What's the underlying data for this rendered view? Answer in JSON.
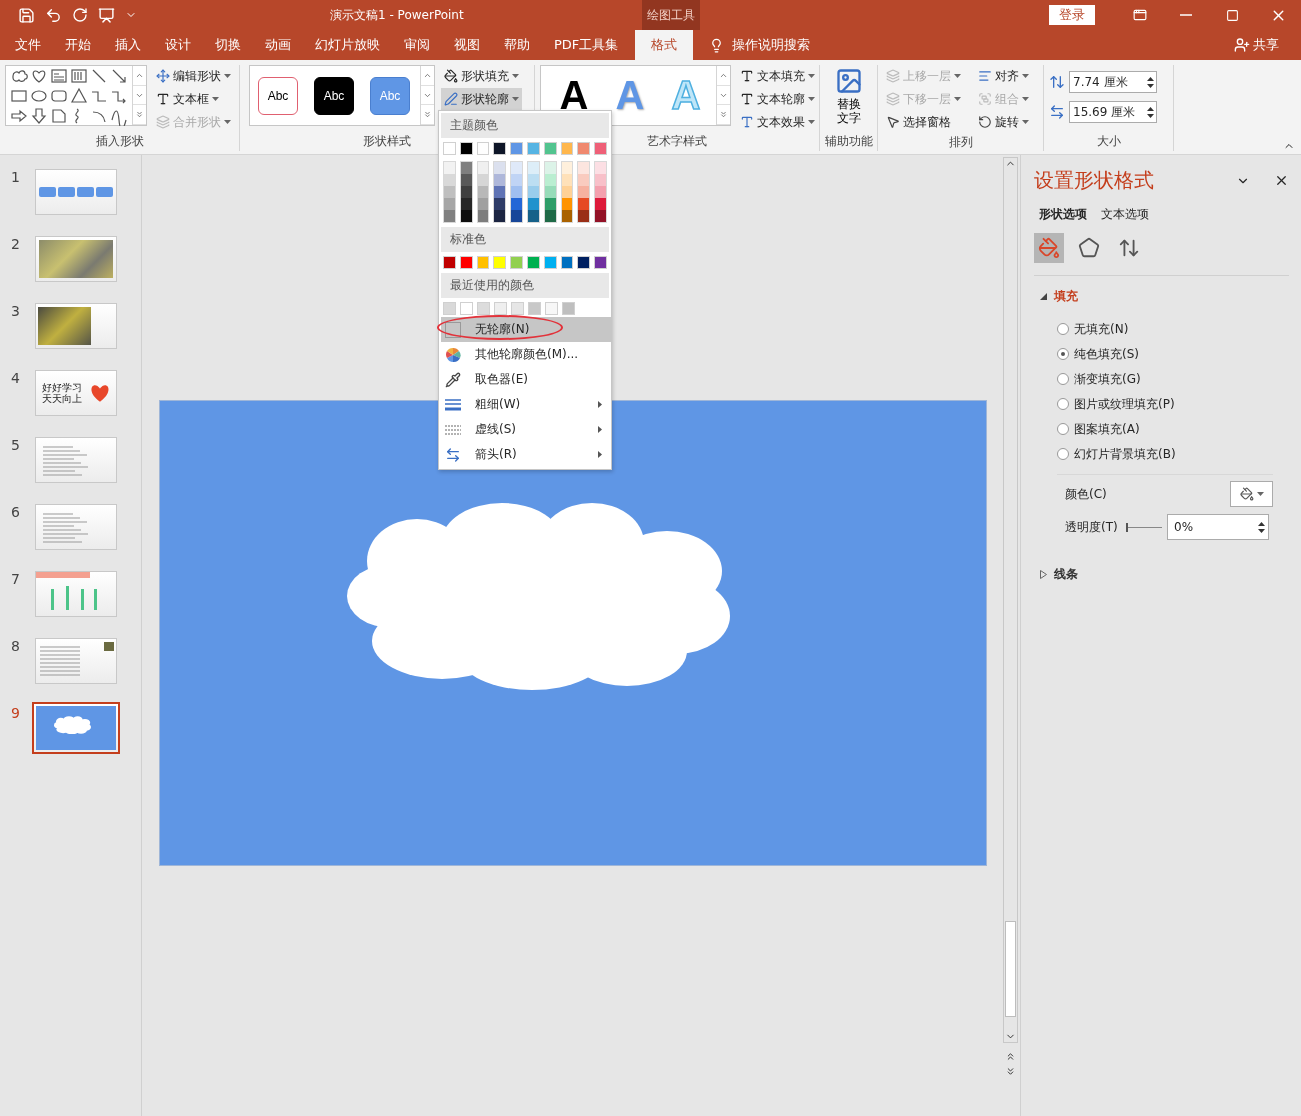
{
  "window": {
    "title": "演示文稿1  -  PowerPoint",
    "context_tab": "绘图工具",
    "login": "登录"
  },
  "tabs": [
    {
      "label": "文件",
      "selected": false
    },
    {
      "label": "开始",
      "selected": false
    },
    {
      "label": "插入",
      "selected": false
    },
    {
      "label": "设计",
      "selected": false
    },
    {
      "label": "切换",
      "selected": false
    },
    {
      "label": "动画",
      "selected": false
    },
    {
      "label": "幻灯片放映",
      "selected": false
    },
    {
      "label": "审阅",
      "selected": false
    },
    {
      "label": "视图",
      "selected": false
    },
    {
      "label": "帮助",
      "selected": false
    },
    {
      "label": "PDF工具集",
      "selected": false
    },
    {
      "label": "格式",
      "selected": true
    }
  ],
  "tell_me": "操作说明搜索",
  "share": "共享",
  "ribbon": {
    "insert_shapes": {
      "label": "插入形状",
      "commands": [
        {
          "label": "编辑形状",
          "disabled": false,
          "dropdown": true
        },
        {
          "label": "文本框",
          "disabled": false,
          "dropdown": true
        },
        {
          "label": "合并形状",
          "disabled": true,
          "dropdown": true
        }
      ]
    },
    "shape_styles": {
      "label": "形状样式",
      "presets": [
        {
          "text": "Abc",
          "kind": "outline"
        },
        {
          "text": "Abc",
          "kind": "dark"
        },
        {
          "text": "Abc",
          "kind": "filled"
        }
      ],
      "commands": [
        {
          "label": "形状填充",
          "open": false
        },
        {
          "label": "形状轮廓",
          "open": true
        }
      ]
    },
    "wordart": {
      "label": "艺术字样式",
      "presets": [
        {
          "text": "A",
          "kind": "black"
        },
        {
          "text": "A",
          "kind": "blue"
        },
        {
          "text": "A",
          "kind": "outline"
        }
      ],
      "commands": [
        {
          "label": "文本填充"
        },
        {
          "label": "文本轮廓"
        },
        {
          "label": "文本效果"
        }
      ]
    },
    "accessibility": {
      "label": "辅助功能",
      "button": "替换文字"
    },
    "arrange": {
      "label": "排列",
      "commands": [
        {
          "label": "上移一层",
          "disabled": true,
          "dropdown": true
        },
        {
          "label": "对齐",
          "disabled": false,
          "dropdown": true
        },
        {
          "label": "下移一层",
          "disabled": true,
          "dropdown": true
        },
        {
          "label": "组合",
          "disabled": true,
          "dropdown": true
        },
        {
          "label": "选择窗格",
          "disabled": false,
          "dropdown": false
        },
        {
          "label": "旋转",
          "disabled": false,
          "dropdown": true
        }
      ]
    },
    "size": {
      "label": "大小",
      "height": "7.74 厘米",
      "width": "15.69 厘米"
    }
  },
  "outline_menu": {
    "theme_heading": "主题颜色",
    "theme_colors": [
      {
        "color": "#ffffff",
        "shades": [
          {
            "color": "#f2f2f2"
          },
          {
            "color": "#d9d9d9"
          },
          {
            "color": "#bfbfbf"
          },
          {
            "color": "#a6a6a6"
          },
          {
            "color": "#808080"
          }
        ]
      },
      {
        "color": "#000000",
        "shades": [
          {
            "color": "#7f7f7f"
          },
          {
            "color": "#595959"
          },
          {
            "color": "#3f3f3f"
          },
          {
            "color": "#262626"
          },
          {
            "color": "#0d0d0d"
          }
        ]
      },
      {
        "color": "#fefefe",
        "shades": [
          {
            "color": "#f0f0f0"
          },
          {
            "color": "#d6d6d6"
          },
          {
            "color": "#b8b8b8"
          },
          {
            "color": "#a0a0a0"
          },
          {
            "color": "#7d7d7d"
          }
        ]
      },
      {
        "color": "#0e1628",
        "shades": [
          {
            "color": "#dbe0ee"
          },
          {
            "color": "#aeb7da"
          },
          {
            "color": "#5f73b5"
          },
          {
            "color": "#2e3c68"
          },
          {
            "color": "#1c2542"
          }
        ]
      },
      {
        "color": "#5f96e5",
        "shades": [
          {
            "color": "#dfe9f9"
          },
          {
            "color": "#c0d4f5"
          },
          {
            "color": "#a0bff0"
          },
          {
            "color": "#2467d6"
          },
          {
            "color": "#184799"
          }
        ]
      },
      {
        "color": "#56b4e3",
        "shades": [
          {
            "color": "#ddeef8"
          },
          {
            "color": "#bcdef2"
          },
          {
            "color": "#99cdec"
          },
          {
            "color": "#2092cd"
          },
          {
            "color": "#166189"
          }
        ]
      },
      {
        "color": "#52c48f",
        "shades": [
          {
            "color": "#dcf3e8"
          },
          {
            "color": "#baeed1"
          },
          {
            "color": "#97dcb9"
          },
          {
            "color": "#2e9e69"
          },
          {
            "color": "#1f6a47"
          }
        ]
      },
      {
        "color": "#ffb74d",
        "shades": [
          {
            "color": "#fff0dc"
          },
          {
            "color": "#ffe1b9"
          },
          {
            "color": "#ffd196"
          },
          {
            "color": "#ff9300"
          },
          {
            "color": "#aa6200"
          }
        ]
      },
      {
        "color": "#f0896f",
        "shades": [
          {
            "color": "#fce5df"
          },
          {
            "color": "#f9cbbf"
          },
          {
            "color": "#f6b1a0"
          },
          {
            "color": "#e64a24"
          },
          {
            "color": "#9a2f17"
          }
        ]
      },
      {
        "color": "#ef6078",
        "shades": [
          {
            "color": "#fcdfe4"
          },
          {
            "color": "#f8c0c9"
          },
          {
            "color": "#f4a0ae"
          },
          {
            "color": "#dd1a3a"
          },
          {
            "color": "#931227"
          }
        ]
      }
    ],
    "standard_heading": "标准色",
    "standard_colors": [
      {
        "color": "#c00000"
      },
      {
        "color": "#ff0000"
      },
      {
        "color": "#ffc000"
      },
      {
        "color": "#ffff00"
      },
      {
        "color": "#92d050"
      },
      {
        "color": "#00b050"
      },
      {
        "color": "#00b0f0"
      },
      {
        "color": "#0070c0"
      },
      {
        "color": "#002060"
      },
      {
        "color": "#7030a0"
      }
    ],
    "recent_heading": "最近使用的颜色",
    "recent_colors": [
      {
        "color": "#d9d9d9"
      },
      {
        "color": "#ffffff"
      },
      {
        "color": "#dcdcdc"
      },
      {
        "color": "#efefef"
      },
      {
        "color": "#e6e6e6"
      },
      {
        "color": "#c8c8c8"
      },
      {
        "color": "#f7f7f7"
      },
      {
        "color": "#bfbfbf"
      }
    ],
    "items": [
      {
        "label": "无轮廓(N)",
        "kind": "none",
        "highlighted": true,
        "circled": true,
        "submenu": false
      },
      {
        "label": "其他轮廓颜色(M)...",
        "kind": "more-colors",
        "highlighted": false,
        "circled": false,
        "submenu": false
      },
      {
        "label": "取色器(E)",
        "kind": "eyedropper",
        "highlighted": false,
        "circled": false,
        "submenu": false
      },
      {
        "label": "粗细(W)",
        "kind": "weight",
        "highlighted": false,
        "circled": false,
        "submenu": true
      },
      {
        "label": "虚线(S)",
        "kind": "dashes",
        "highlighted": false,
        "circled": false,
        "submenu": true
      },
      {
        "label": "箭头(R)",
        "kind": "arrows",
        "highlighted": false,
        "circled": false,
        "submenu": true
      }
    ]
  },
  "slides": [
    {
      "number": "1",
      "kind": "boxes",
      "selected": false
    },
    {
      "number": "2",
      "kind": "photo",
      "selected": false
    },
    {
      "number": "3",
      "kind": "photo-left",
      "selected": false
    },
    {
      "number": "4",
      "kind": "text-heart",
      "text": "好好学习天天向上",
      "selected": false
    },
    {
      "number": "5",
      "kind": "text-lines",
      "selected": false
    },
    {
      "number": "6",
      "kind": "text-lines",
      "selected": false
    },
    {
      "number": "7",
      "kind": "chart",
      "selected": false
    },
    {
      "number": "8",
      "kind": "text-photo",
      "selected": false
    },
    {
      "number": "9",
      "kind": "cloud",
      "selected": true
    }
  ],
  "format_pane": {
    "title": "设置形状格式",
    "tabs": [
      {
        "label": "形状选项",
        "selected": true
      },
      {
        "label": "文本选项",
        "selected": false
      }
    ],
    "icon_tabs": [
      {
        "kind": "fill",
        "selected": true
      },
      {
        "kind": "effects",
        "selected": false
      },
      {
        "kind": "size",
        "selected": false
      }
    ],
    "sections": [
      {
        "label": "填充",
        "kind": "fill",
        "expanded": true
      },
      {
        "label": "线条",
        "kind": "line",
        "expanded": false
      }
    ],
    "fill_options": [
      {
        "label": "无填充(N)",
        "selected": false
      },
      {
        "label": "纯色填充(S)",
        "selected": true
      },
      {
        "label": "渐变填充(G)",
        "selected": false
      },
      {
        "label": "图片或纹理填充(P)",
        "selected": false
      },
      {
        "label": "图案填充(A)",
        "selected": false
      },
      {
        "label": "幻灯片背景填充(B)",
        "selected": false
      }
    ],
    "color_label": "颜色(C)",
    "transparency_label": "透明度(T)",
    "transparency": {
      "value": "0%",
      "level": 0
    }
  }
}
